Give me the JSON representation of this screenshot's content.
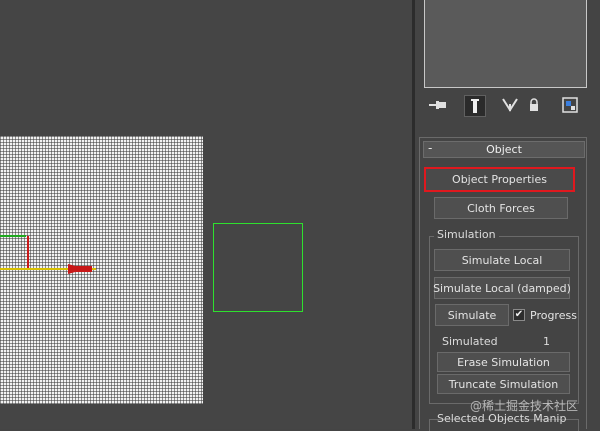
{
  "rollout": {
    "collapse_symbol": "-",
    "title": "Object",
    "buttons": {
      "object_properties": "Object Properties",
      "cloth_forces": "Cloth Forces"
    },
    "simulation": {
      "group_label": "Simulation",
      "simulate_local": "Simulate Local",
      "simulate_local_damped": "Simulate Local (damped)",
      "simulate": "Simulate",
      "progress_label": "Progress",
      "progress_checked": true,
      "check_mark": "✔",
      "simulated_label": "Simulated",
      "simulated_value": "1",
      "erase_simulation": "Erase Simulation",
      "truncate_simulation": "Truncate Simulation"
    },
    "next_section_label": "Selected Objects Manip"
  },
  "watermark": "@稀土掘金技术社区",
  "colors": {
    "highlight_red": "#e0181e",
    "selection_green": "#2ee02e",
    "axis_red": "#c81818",
    "axis_green": "#1fa81f",
    "axis_yellow": "#d8c000"
  },
  "icons": [
    "pin-stack-icon",
    "modify-tab-icon",
    "funnel-icon",
    "lock-icon",
    "configure-sets-icon"
  ]
}
